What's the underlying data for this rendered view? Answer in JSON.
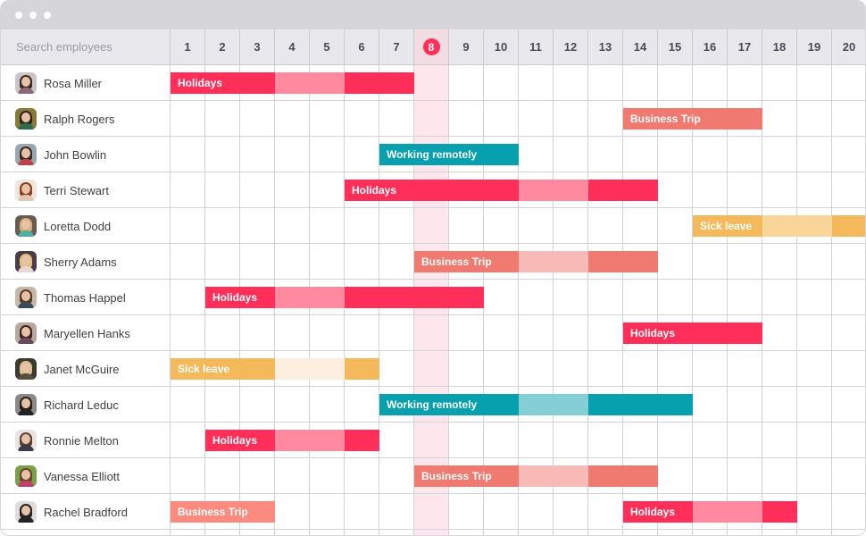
{
  "window": {
    "controls": [
      "dot",
      "dot",
      "dot"
    ]
  },
  "search": {
    "placeholder": "Search employees",
    "value": ""
  },
  "calendar": {
    "days": [
      "1",
      "2",
      "3",
      "4",
      "5",
      "6",
      "7",
      "8",
      "9",
      "10",
      "11",
      "12",
      "13",
      "14",
      "15",
      "16",
      "17",
      "18",
      "19",
      "20"
    ],
    "today": "8"
  },
  "colors": {
    "holidays": {
      "solid": "#ff2f5a",
      "light": "#ff8aa0"
    },
    "business_trip": {
      "solid": "#f07970",
      "light": "#f7bab6",
      "alt": "#fd8a7f"
    },
    "working_remotely": {
      "solid": "#07a0ae",
      "light": "#84cfd5"
    },
    "sick_leave": {
      "solid": "#f3b95a",
      "light": "#fad59a",
      "faint": "#fdefdf"
    },
    "today_highlight": "#fde6ec",
    "today_badge": "#ff2f5a"
  },
  "employees": [
    {
      "name": "Rosa Miller",
      "avatar": {
        "hair": "#3a2a22",
        "shirt": "#8a6a7a",
        "bg": "#c9c6c8"
      },
      "events": [
        {
          "type": "holidays",
          "label": "Holidays",
          "start": 1,
          "end": 7,
          "light_days": [
            4,
            5
          ]
        }
      ]
    },
    {
      "name": "Ralph Rogers",
      "avatar": {
        "hair": "#2d2520",
        "shirt": "#2e6b4a",
        "bg": "#8a7a3a"
      },
      "events": [
        {
          "type": "business_trip",
          "label": "Business Trip",
          "start": 14,
          "end": 17,
          "light_days": []
        }
      ]
    },
    {
      "name": "John Bowlin",
      "avatar": {
        "hair": "#3a2b22",
        "shirt": "#c0404a",
        "bg": "#9aa6b0"
      },
      "events": [
        {
          "type": "working_remotely",
          "label": "Working remotely",
          "start": 7,
          "end": 10,
          "light_days": []
        }
      ]
    },
    {
      "name": "Terri Stewart",
      "avatar": {
        "hair": "#8a3e22",
        "shirt": "#e2c4b0",
        "bg": "#f0e6e0"
      },
      "events": [
        {
          "type": "holidays",
          "label": "Holidays",
          "start": 6,
          "end": 14,
          "light_days": [
            11,
            12
          ]
        }
      ]
    },
    {
      "name": "Loretta Dodd",
      "avatar": {
        "hair": "#d3b07a",
        "shirt": "#4fb0a0",
        "bg": "#6a5a55"
      },
      "events": [
        {
          "type": "sick_leave",
          "label": "Sick leave",
          "start": 16,
          "end": 20,
          "light_days": [
            18,
            19
          ]
        }
      ]
    },
    {
      "name": "Sherry Adams",
      "avatar": {
        "hair": "#e0c07a",
        "shirt": "#e8d8d0",
        "bg": "#4a3a4a"
      },
      "events": [
        {
          "type": "business_trip",
          "label": "Business Trip",
          "start": 8,
          "end": 14,
          "light_days": [
            11,
            12
          ]
        }
      ]
    },
    {
      "name": "Thomas Happel",
      "avatar": {
        "hair": "#5a3a28",
        "shirt": "#3a4a5a",
        "bg": "#c8b8a8"
      },
      "events": [
        {
          "type": "holidays",
          "label": "Holidays",
          "start": 2,
          "end": 9,
          "light_days": [
            4,
            5
          ]
        }
      ]
    },
    {
      "name": "Maryellen Hanks",
      "avatar": {
        "hair": "#3a2420",
        "shirt": "#6a4a5a",
        "bg": "#b8a8a0"
      },
      "events": [
        {
          "type": "holidays",
          "label": "Holidays",
          "start": 14,
          "end": 17,
          "light_days": []
        }
      ]
    },
    {
      "name": "Janet McGuire",
      "avatar": {
        "hair": "#d8c090",
        "shirt": "#5a5040",
        "bg": "#3a3a30"
      },
      "events": [
        {
          "type": "sick_leave",
          "label": "Sick leave",
          "start": 1,
          "end": 6,
          "light_days": [
            4,
            5
          ],
          "light_style": "faint"
        }
      ]
    },
    {
      "name": "Richard Leduc",
      "avatar": {
        "hair": "#2a2018",
        "shirt": "#222226",
        "bg": "#8a8a8a"
      },
      "events": [
        {
          "type": "working_remotely",
          "label": "Working remotely",
          "start": 7,
          "end": 15,
          "light_days": [
            11,
            12
          ]
        }
      ]
    },
    {
      "name": "Ronnie Melton",
      "avatar": {
        "hair": "#5a4030",
        "shirt": "#3a3a48",
        "bg": "#e8e4e4"
      },
      "events": [
        {
          "type": "holidays",
          "label": "Holidays",
          "start": 2,
          "end": 6,
          "light_days": [
            4,
            5
          ]
        }
      ]
    },
    {
      "name": "Vanessa Elliott",
      "avatar": {
        "hair": "#6a4428",
        "shirt": "#c0406a",
        "bg": "#7aa04a"
      },
      "events": [
        {
          "type": "business_trip",
          "label": "Business Trip",
          "start": 8,
          "end": 14,
          "light_days": [
            11,
            12
          ]
        }
      ]
    },
    {
      "name": "Rachel Bradford",
      "avatar": {
        "hair": "#2a2020",
        "shirt": "#222228",
        "bg": "#e0dcdc"
      },
      "events": [
        {
          "type": "business_trip",
          "label": "Business Trip",
          "start": 1,
          "end": 3,
          "light_days": [],
          "style": "alt"
        },
        {
          "type": "holidays",
          "label": "Holidays",
          "start": 14,
          "end": 18,
          "light_days": [
            16,
            17
          ]
        }
      ]
    }
  ]
}
